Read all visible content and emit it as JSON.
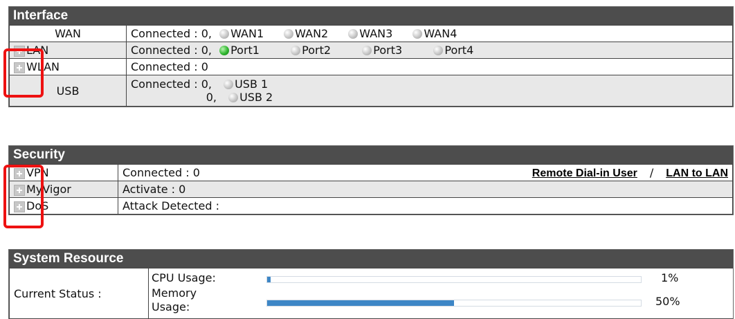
{
  "interface": {
    "title": "Interface",
    "wan": {
      "label": "WAN",
      "status": "Connected : 0,",
      "ports": [
        "WAN1",
        "WAN2",
        "WAN3",
        "WAN4"
      ]
    },
    "lan": {
      "label": "LAN",
      "status": "Connected : 0,",
      "ports": [
        "Port1",
        "Port2",
        "Port3",
        "Port4"
      ],
      "active_port": "Port1"
    },
    "wlan": {
      "label": "WLAN",
      "status": "Connected : 0"
    },
    "usb": {
      "label": "USB",
      "status1": "Connected : 0,",
      "status2": "0,",
      "ports": [
        "USB 1",
        "USB 2"
      ]
    }
  },
  "security": {
    "title": "Security",
    "vpn": {
      "label": "VPN",
      "status": "Connected : 0",
      "link1": "Remote Dial-in User",
      "separator": "/",
      "link2": "LAN to LAN"
    },
    "myvigor": {
      "label": "MyVigor",
      "status": "Activate : 0"
    },
    "dos": {
      "label": "DoS",
      "status": "Attack Detected :"
    }
  },
  "system": {
    "title": "System Resource",
    "current_status_label": "Current Status :",
    "cpu": {
      "label": "CPU Usage:",
      "value_text": "1%",
      "percent": 1
    },
    "memory": {
      "label1": "Memory",
      "label2": "Usage:",
      "value_text": "50%",
      "percent": 50
    }
  },
  "colors": {
    "header_bg": "#4d4d4d",
    "row_alt": "#e8e8e8",
    "led_on": "#2fb52f",
    "led_off": "#c6c6c6",
    "bar_fill": "#3d86c6",
    "highlight": "#ee1111"
  }
}
